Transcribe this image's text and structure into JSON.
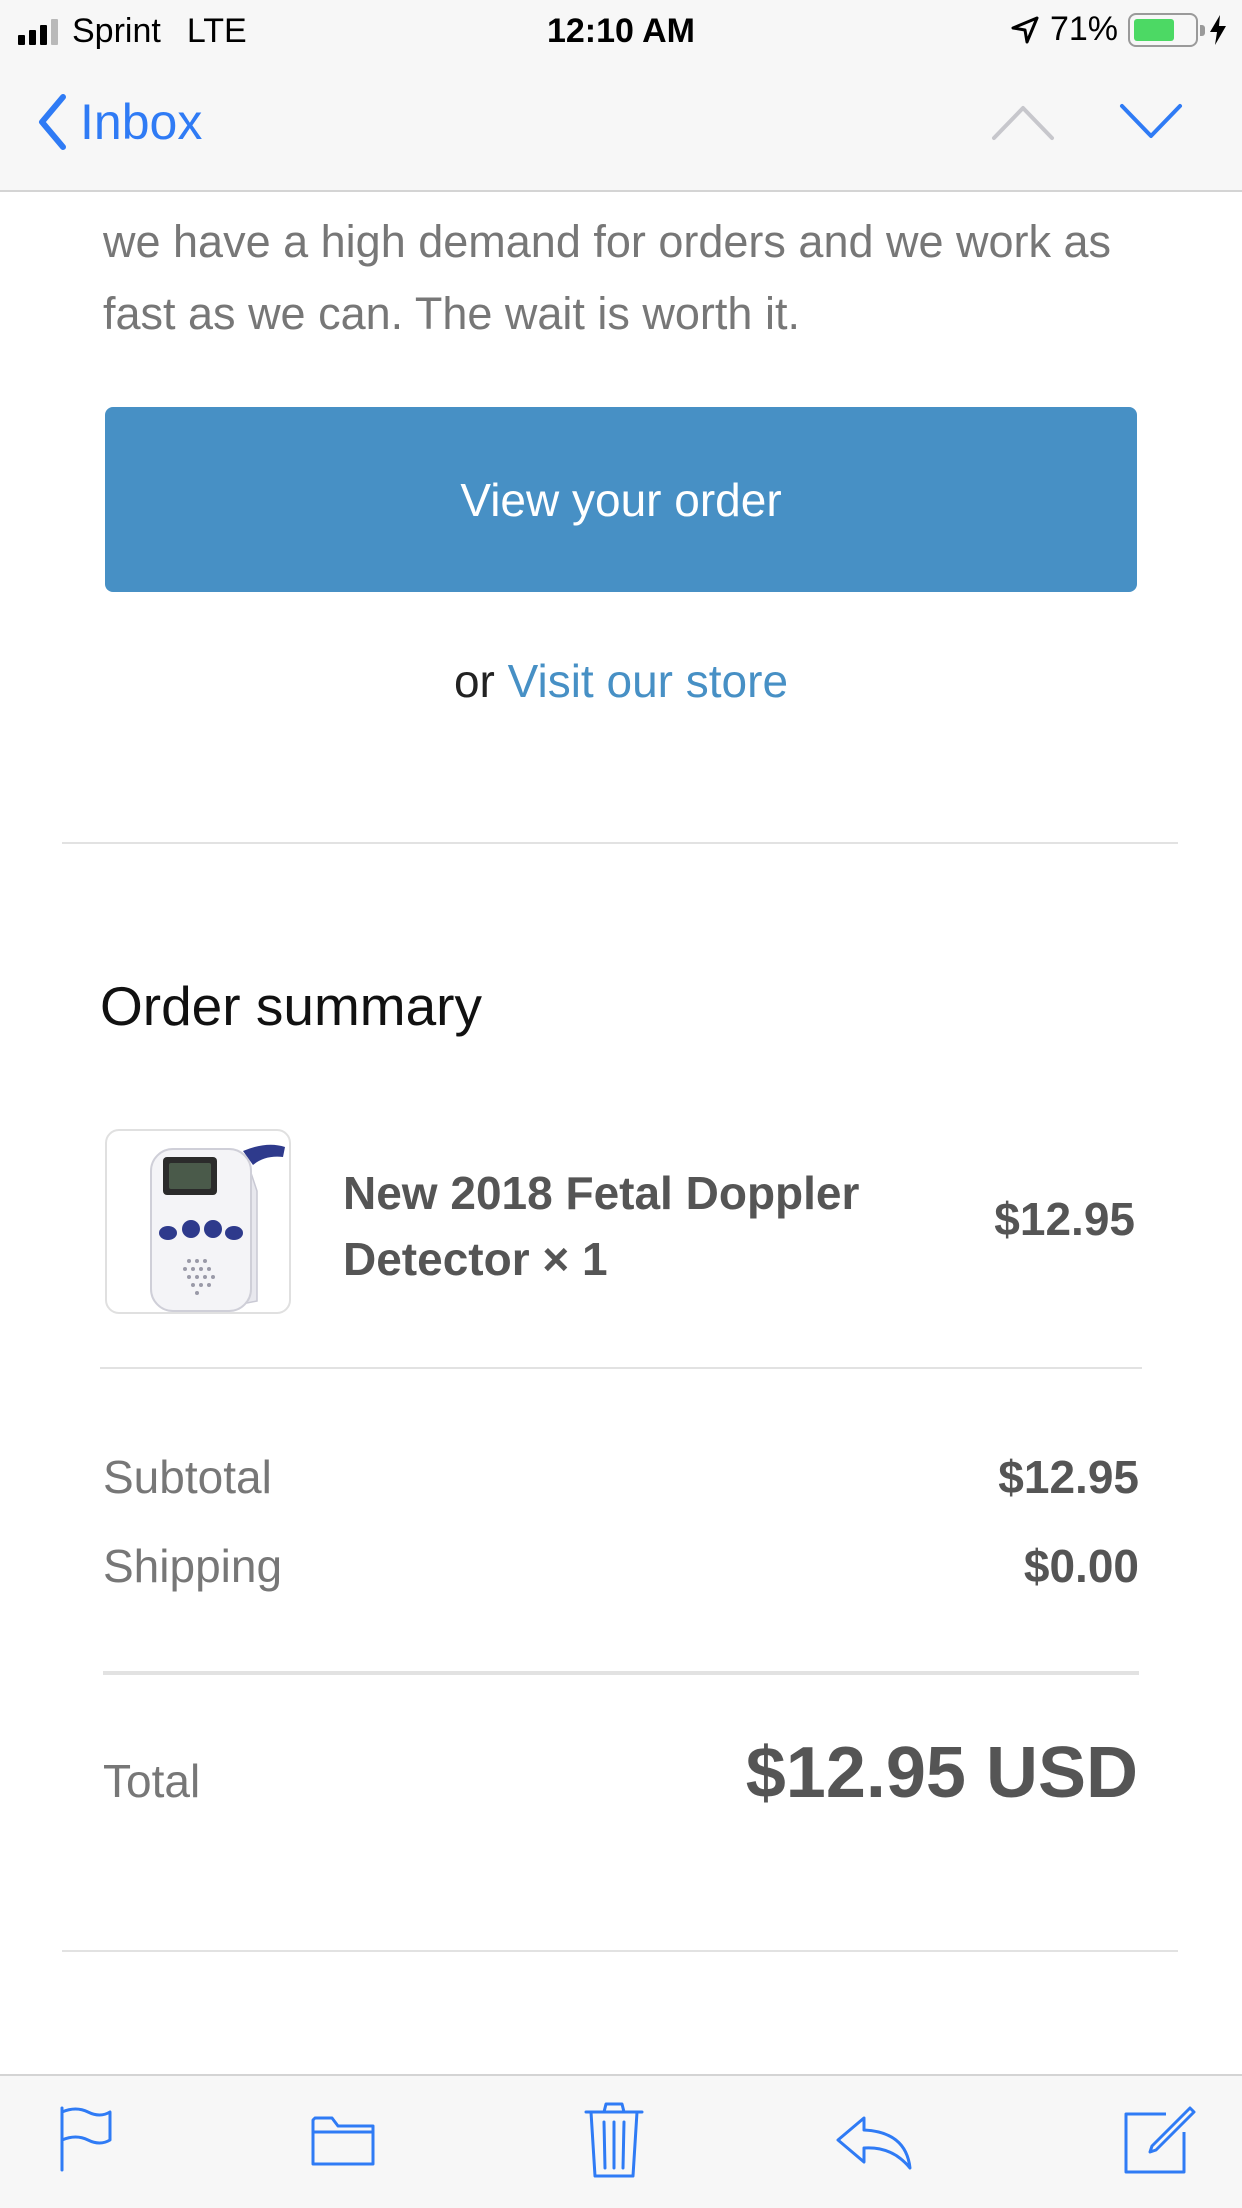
{
  "status_bar": {
    "carrier": "Sprint",
    "network": "LTE",
    "time": "12:10 AM",
    "battery_percent": "71%",
    "battery_level": 0.71
  },
  "nav": {
    "back_label": "Inbox"
  },
  "email": {
    "intro_text": "we have a high demand for orders and we work as fast as we can. The wait is worth it.",
    "cta_label": "View your order",
    "alt_prefix": "or",
    "store_link_label": "Visit our store"
  },
  "order_summary": {
    "title": "Order summary",
    "item": {
      "name": "New 2018 Fetal Doppler Detector × 1",
      "price": "$12.95"
    },
    "subtotal_label": "Subtotal",
    "subtotal_value": "$12.95",
    "shipping_label": "Shipping",
    "shipping_value": "$0.00",
    "total_label": "Total",
    "total_value": "$12.95 USD"
  },
  "colors": {
    "accent_blue": "#2f7bf5",
    "button_blue": "#4790c5",
    "battery_green": "#4cd964"
  },
  "toolbar": {
    "icons": [
      "flag-icon",
      "folder-icon",
      "trash-icon",
      "reply-icon",
      "compose-icon"
    ]
  }
}
